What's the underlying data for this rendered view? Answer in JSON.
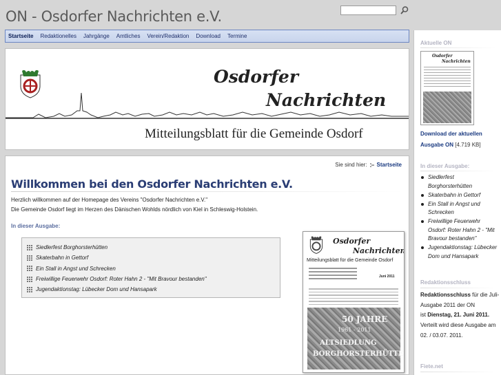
{
  "site": {
    "title": "ON - Osdorfer Nachrichten e.V."
  },
  "search": {
    "value": "",
    "placeholder": ""
  },
  "nav": {
    "items": [
      {
        "label": "Startseite"
      },
      {
        "label": "Redaktionelles"
      },
      {
        "label": "Jahrgänge"
      },
      {
        "label": "Amtliches"
      },
      {
        "label": "Verein/Redaktion"
      },
      {
        "label": "Download"
      },
      {
        "label": "Termine"
      }
    ]
  },
  "banner": {
    "title1": "Osdorfer",
    "title2": "Nachrichten",
    "subtitle": "Mitteilungsblatt für die Gemeinde Osdorf"
  },
  "breadcrumb": {
    "prefix": "Sie sind hier:",
    "current": "Startseite"
  },
  "main": {
    "heading": "Willkommen bei den Osdorfer Nachrichten e.V.",
    "intro1": "Herzlich willkommen auf der Homepage des Vereins \"Osdorfer Nachrichten e.V.\"",
    "intro2": "Die Gemeinde Osdorf liegt im Herzen des Dänischen Wohlds nördlich von Kiel in Schleswig-Holstein.",
    "issue_heading": "In dieser Ausgabe:",
    "issue_items": [
      "Siedlerfest Borghorsterhütten",
      "Skaterbahn in Gettorf",
      "Ein Stall in Angst und Schrecken",
      "Freiwillige Feuerwehr Osdorf: Roter Hahn 2 - \"Mit Bravour bestanden\"",
      "Jugendaktionstag: Lübecker Dom und Hansapark"
    ]
  },
  "cover": {
    "title1": "Osdorfer",
    "title2": "Nachrichten",
    "subtitle": "Mitteilungsblatt für die Gemeinde Osdorf",
    "date": "Juni 2011",
    "stone_line1": "50 JAHRE",
    "stone_line2": "1961 - 2011",
    "stone_line3": "ALTSIEDLUNG",
    "stone_line4": "BORGHORSTERHÜTTEN"
  },
  "sidebar": {
    "current_heading": "Aktuelle ON",
    "download_link": "Download der aktuellen Ausgabe ON",
    "download_size": "[4.719 KB]",
    "issue_heading": "In dieser Ausgabe:",
    "issue_items": [
      "Siedlerfest Borghorsterhütten",
      "Skaterbahn in Gettorf",
      "Ein Stall in Angst und Schrecken",
      "Freiwillige Feuerwehr Osdorf: Roter Hahn 2 - \"Mit Bravour bestanden\"",
      "Jugendaktionstag: Lübecker Dom und Hansapark"
    ],
    "deadline_heading": "Redaktionsschluss",
    "deadline_bold": "Redaktionsschluss",
    "deadline_text1": "für die Juli-Ausgabe 2011 der ON",
    "deadline_text2": "ist",
    "deadline_date": "Dienstag, 21. Juni 2011.",
    "deadline_text3": "Verteilt wird diese Ausgabe am 02. / 03.07. 2011.",
    "footer_heading": "Fiete.net"
  },
  "colors": {
    "nav_bg": "#c8d4ec",
    "nav_border": "#6c86c2",
    "link": "#1a3a80",
    "heading": "#2a3d74",
    "sidebar_heading": "#b4b4c2"
  }
}
